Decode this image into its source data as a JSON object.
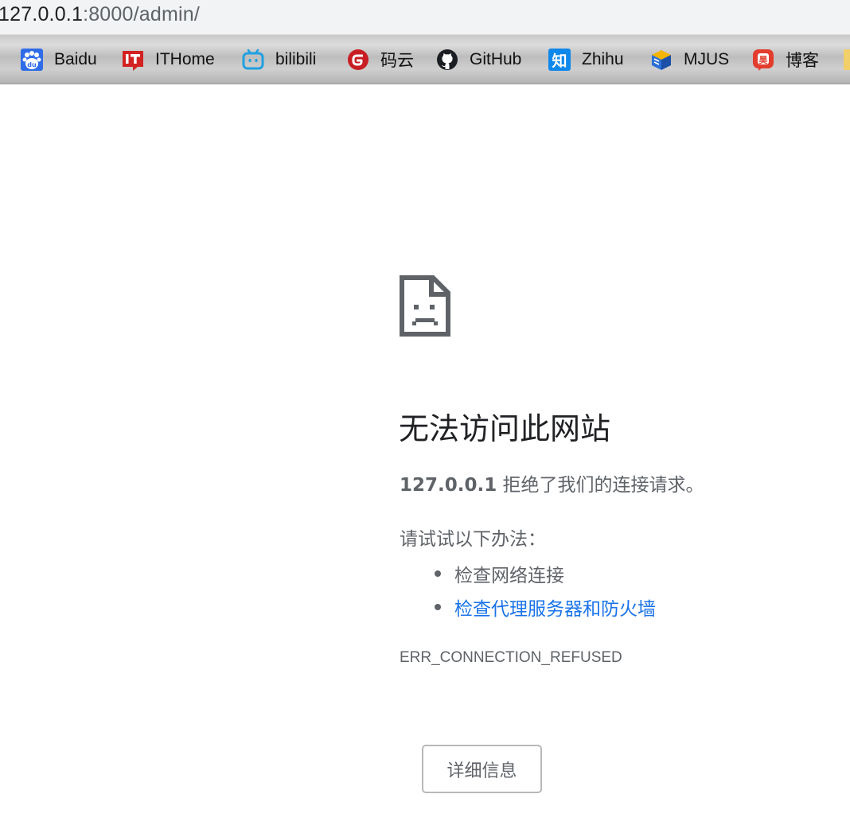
{
  "address_bar": {
    "host": "127.0.0.1",
    "path": ":8000/admin/"
  },
  "bookmarks": [
    {
      "label": "Baidu",
      "icon": "baidu-paw-icon"
    },
    {
      "label": "ITHome",
      "icon": "ithome-icon"
    },
    {
      "label": "bilibili",
      "icon": "bilibili-tv-icon"
    },
    {
      "label": "码云",
      "icon": "gitee-icon"
    },
    {
      "label": "GitHub",
      "icon": "github-octocat-icon"
    },
    {
      "label": "Zhihu",
      "icon": "zhihu-icon"
    },
    {
      "label": "MJUS",
      "icon": "mjus-cube-icon"
    },
    {
      "label": "博客",
      "icon": "blog-icon"
    }
  ],
  "error": {
    "icon": "sad-page-icon",
    "title": "无法访问此网站",
    "host": "127.0.0.1",
    "desc_text": " 拒绝了我们的连接请求。",
    "try_label": "请试试以下办法：",
    "suggestions": [
      {
        "text": "检查网络连接",
        "is_link": false
      },
      {
        "text": "检查代理服务器和防火墙",
        "is_link": true
      }
    ],
    "code": "ERR_CONNECTION_REFUSED",
    "details_button": "详细信息"
  },
  "colors": {
    "link": "#1a73e8",
    "secondary_text": "#5f6368",
    "title_text": "#202124"
  }
}
